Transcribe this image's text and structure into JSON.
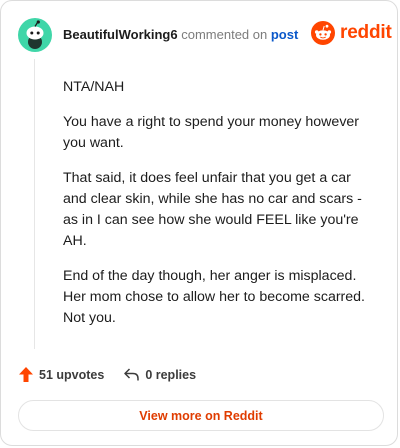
{
  "comment": {
    "username": "BeautifulWorking6",
    "commented_on": "commented on",
    "post_link": "post",
    "brand": "reddit",
    "paragraphs": [
      "NTA/NAH",
      "You have a right to spend your money however you want.",
      "That said, it does feel unfair that you get a car and clear skin, while she has no car and scars - as in I can see how she would FEEL like you're AH.",
      "End of the day though, her anger is misplaced. Her mom chose to allow her to become scarred. Not you."
    ]
  },
  "actions": {
    "upvotes": "51 upvotes",
    "replies": "0 replies"
  },
  "view_more": "View more on Reddit",
  "colors": {
    "accent": "#ff4500",
    "avatar": "#3fd6a8",
    "link": "#0a58ca"
  },
  "icons": [
    "avatar-snoo-icon",
    "reddit-logo-icon",
    "upvote-arrow-icon",
    "reply-icon"
  ]
}
